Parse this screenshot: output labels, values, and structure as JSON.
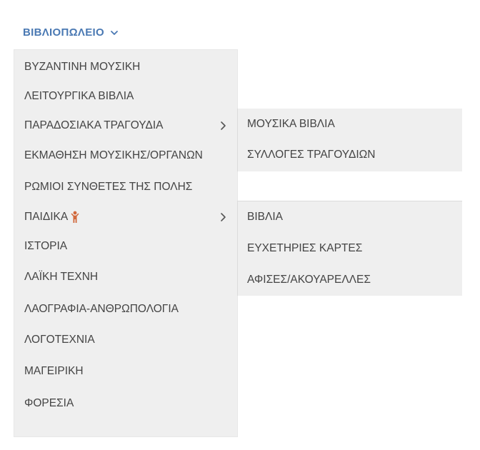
{
  "nav": {
    "title": "ΒΙΒΛΙΟΠΩΛΕΙΟ",
    "chevron_icon": "chevron-down-icon",
    "accent_color": "#4a79b3"
  },
  "menu": {
    "items": [
      {
        "label": "ΒΥΖΑΝΤΙΝΗ ΜΟΥΣΙΚΗ"
      },
      {
        "label": "ΛΕΙΤΟΥΡΓΙΚΑ ΒΙΒΛΙΑ"
      },
      {
        "label": "ΠΑΡΑΔΟΣΙΑΚΑ ΤΡΑΓΟΥΔΙΑ",
        "has_submenu": true
      },
      {
        "label": "ΕΚΜΑΘΗΣΗ ΜΟΥΣΙΚΗΣ/ΟΡΓΑΝΩΝ"
      },
      {
        "label": "ΡΩΜΙΟΙ ΣΥΝΘΕΤΕΣ ΤΗΣ ΠΟΛΗΣ"
      },
      {
        "label": "ΠΑΙΔΙΚΑ",
        "has_submenu": true,
        "icon": "child-icon"
      },
      {
        "label": "ΙΣΤΟΡΙΑ"
      },
      {
        "label": "ΛΑΪΚΗ ΤΕΧΝΗ"
      },
      {
        "label": "ΛΑΟΓΡΑΦΙΑ-ΑΝΘΡΩΠΟΛΟΓΙΑ"
      },
      {
        "label": "ΛΟΓΟΤΕΧΝΙΑ"
      },
      {
        "label": "ΜΑΓΕΙΡΙΚΗ"
      },
      {
        "label": "ΦΟΡΕΣΙΑ"
      }
    ]
  },
  "submenu_traditional": {
    "items": [
      {
        "label": "ΜΟΥΣΙΚΑ ΒΙΒΛΙΑ"
      },
      {
        "label": "ΣΥΛΛΟΓΕΣ ΤΡΑΓΟΥΔΙΩΝ"
      }
    ]
  },
  "submenu_kids": {
    "items": [
      {
        "label": "ΒΙΒΛΙΑ"
      },
      {
        "label": "ΕΥΧΕΤΗΡΙΕΣ ΚΑΡΤΕΣ"
      },
      {
        "label": "ΑΦΙΣΕΣ/ΑΚΟΥΑΡΕΛΛΕΣ"
      }
    ]
  },
  "colors": {
    "menu_bg": "#efefef",
    "text": "#444444",
    "kid_icon": "#d2693c"
  }
}
